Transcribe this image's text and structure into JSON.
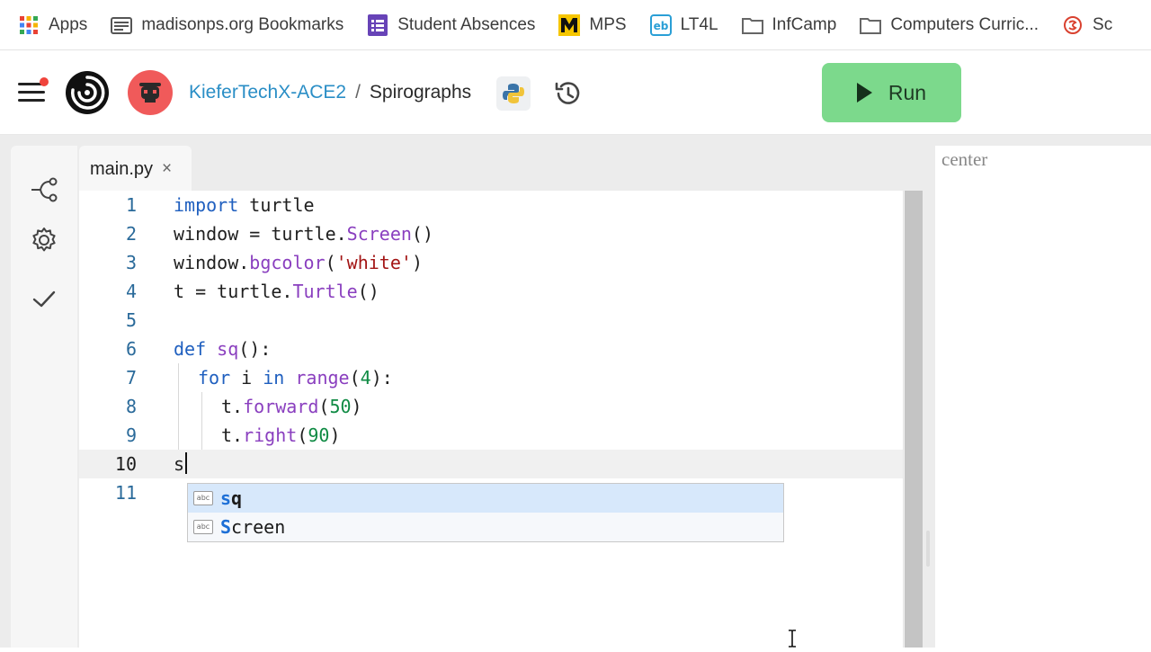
{
  "bookmarks": [
    {
      "label": "Apps",
      "icon": "apps-grid-icon"
    },
    {
      "label": "madisonps.org Bookmarks",
      "icon": "folder-icon"
    },
    {
      "label": "Student Absences",
      "icon": "forms-icon"
    },
    {
      "label": "MPS",
      "icon": "mps-logo-icon"
    },
    {
      "label": "LT4L",
      "icon": "lt4l-icon"
    },
    {
      "label": "InfCamp",
      "icon": "folder-icon"
    },
    {
      "label": "Computers Curric...",
      "icon": "folder-icon"
    },
    {
      "label": "Sc",
      "icon": "site-icon"
    }
  ],
  "header": {
    "team": "KieferTechX-ACE2",
    "separator": "/",
    "repl_name": "Spirographs",
    "run_label": "Run"
  },
  "editor": {
    "tab_label": "main.py",
    "tab_close": "×",
    "lines": [
      {
        "n": "1"
      },
      {
        "n": "2"
      },
      {
        "n": "3"
      },
      {
        "n": "4"
      },
      {
        "n": "5"
      },
      {
        "n": "6"
      },
      {
        "n": "7"
      },
      {
        "n": "8"
      },
      {
        "n": "9"
      },
      {
        "n": "10"
      },
      {
        "n": "11"
      }
    ],
    "tokens": {
      "import": "import",
      "turtle": " turtle",
      "window": "window = turtle.",
      "Screen": "Screen",
      "paren": "()",
      "window_bg": "window.",
      "bgcolor": "bgcolor",
      "open": "(",
      "white": "'white'",
      "close": ")",
      "t_eq": "t = turtle.",
      "Turtle": "Turtle",
      "def": "def",
      "sq": " sq",
      "def_tail": "():",
      "for": "for",
      "i": " i ",
      "in": "in",
      "range": " range",
      "four": "4",
      "range_tail": "):",
      "t_dot": "t.",
      "forward": "forward",
      "fifty": "50",
      "right": "right",
      "ninety": "90",
      "typed": "s"
    },
    "autocomplete": [
      {
        "match": "s",
        "rest": "q",
        "badge": "abc"
      },
      {
        "match": "S",
        "rest": "creen",
        "badge": "abc"
      }
    ]
  },
  "output": {
    "text": "center"
  }
}
